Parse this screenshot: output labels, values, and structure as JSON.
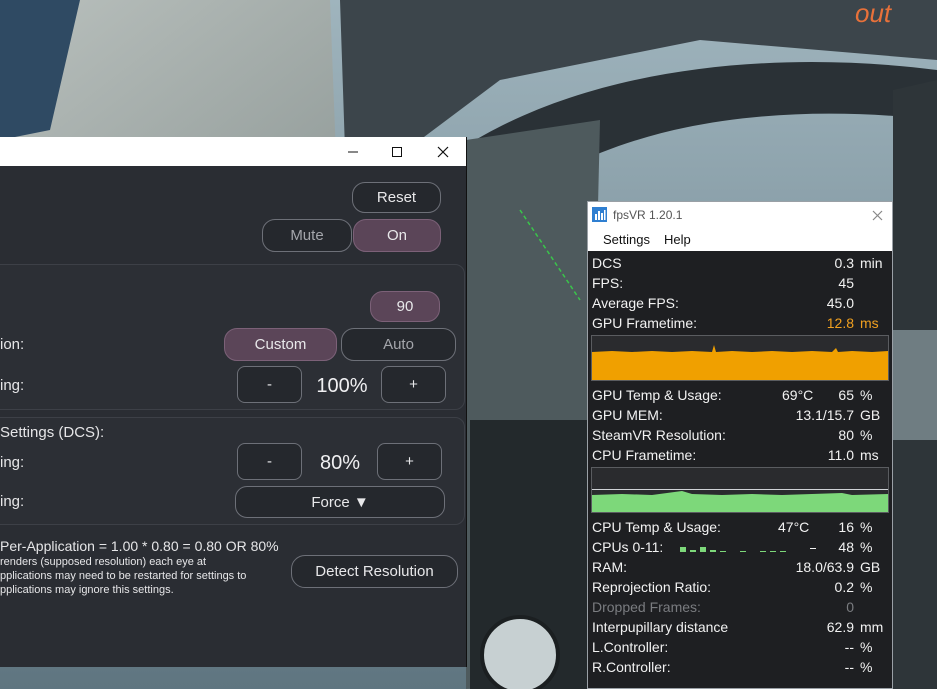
{
  "settings_window": {
    "controls": {
      "minimize": "—",
      "maximize": "☐",
      "close": "✕"
    },
    "reset_label": "Reset",
    "mute_label": "Mute",
    "on_label": "On",
    "refresh_value": "90",
    "row_ion_label": "ion:",
    "custom_label": "Custom",
    "auto_label": "Auto",
    "row_ing1_label": "ing:",
    "minus_label": "-",
    "plus_label": "+",
    "supersample_value": "100%",
    "app_section_title": "Settings (DCS):",
    "row_ing2_label": "ing:",
    "app_value": "80%",
    "row_ing3_label": "ing:",
    "force_label": "Force ▼",
    "formula": "Per-Application = 1.00 * 0.80 = 0.80 OR 80%",
    "note_lines": [
      " renders (supposed resolution) each eye at",
      "pplications may need to be restarted for settings to",
      "pplications may ignore this settings."
    ],
    "detect_label": "Detect Resolution"
  },
  "fpsvr": {
    "title": "fpsVR 1.20.1",
    "close": "✕",
    "menu": [
      "Settings",
      "Help"
    ],
    "rows_top": [
      {
        "label": "DCS",
        "value": "0.3",
        "unit": "min"
      },
      {
        "label": "FPS:",
        "value": "45",
        "unit": ""
      },
      {
        "label": "Average FPS:",
        "value": "45.0",
        "unit": ""
      },
      {
        "label": "GPU Frametime:",
        "value": "12.8",
        "unit": "ms"
      }
    ],
    "rows_gpu": [
      {
        "label": "GPU Temp & Usage:",
        "temp": "69°C",
        "value": "65",
        "unit": "%"
      },
      {
        "label": "GPU MEM:",
        "value": "13.1/15.7",
        "unit": "GB"
      },
      {
        "label": "SteamVR Resolution:",
        "value": "80",
        "unit": "%"
      },
      {
        "label": "CPU Frametime:",
        "value": "11.0",
        "unit": "ms"
      }
    ],
    "rows_cpu": [
      {
        "label": "CPU Temp & Usage:",
        "temp": "47°C",
        "value": "16",
        "unit": "%"
      },
      {
        "label": "CPUs 0-11:",
        "value": "48",
        "unit": "%"
      },
      {
        "label": "RAM:",
        "value": "18.0/63.9",
        "unit": "GB"
      },
      {
        "label": "Reprojection Ratio:",
        "value": "0.2",
        "unit": "%"
      },
      {
        "label": "Dropped Frames:",
        "value": "0",
        "unit": ""
      },
      {
        "label": "Interpupillary distance",
        "value": "62.9",
        "unit": "mm"
      },
      {
        "label": "L.Controller:",
        "value": "--",
        "unit": "%"
      },
      {
        "label": "R.Controller:",
        "value": "--",
        "unit": "%"
      }
    ],
    "colors": {
      "gpu_frametime": "#f0a020",
      "cpu_graph": "#7dd87a",
      "gpu_graph": "#f0a000"
    }
  },
  "scene": {
    "text_fragment": "out"
  }
}
